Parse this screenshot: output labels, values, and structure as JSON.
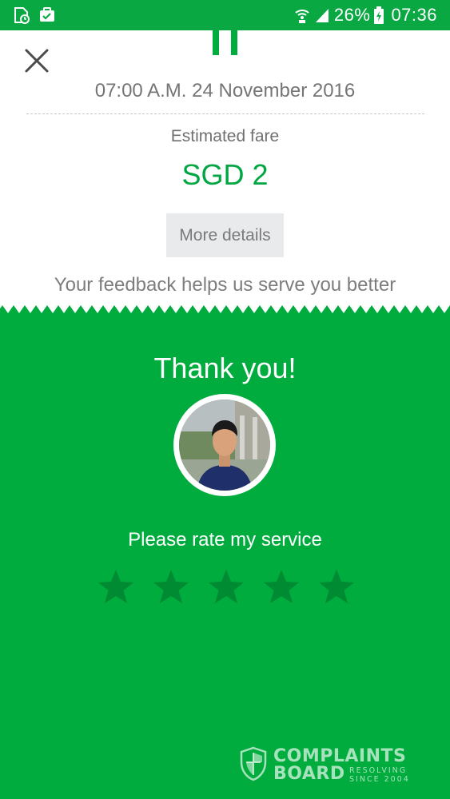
{
  "status_bar": {
    "battery_percent": "26%",
    "time": "07:36"
  },
  "trip": {
    "datetime": "07:00 A.M. 24 November 2016",
    "fare_label": "Estimated fare",
    "fare_value": "SGD 2",
    "more_details_label": "More details",
    "feedback_prompt": "Your feedback helps us serve you better"
  },
  "rating": {
    "title": "Thank you!",
    "prompt": "Please rate my service",
    "stars_total": 5,
    "stars_selected": 0
  },
  "watermark": {
    "line1": "COMPLAINTS",
    "line2": "BOARD",
    "tag1": "RESOLVING",
    "tag2": "SINCE 2004"
  },
  "colors": {
    "brand_green": "#00ac3d",
    "status_bar_green": "#0aa843",
    "fare_green": "#00a642",
    "star_unselected": "#008a32"
  },
  "icons": {
    "status_left": [
      "sim-card-icon",
      "briefcase-check-icon"
    ],
    "status_right": [
      "wifi-call-icon",
      "signal-icon",
      "battery-charging-icon"
    ],
    "close": "close-icon",
    "star": "star-icon"
  }
}
